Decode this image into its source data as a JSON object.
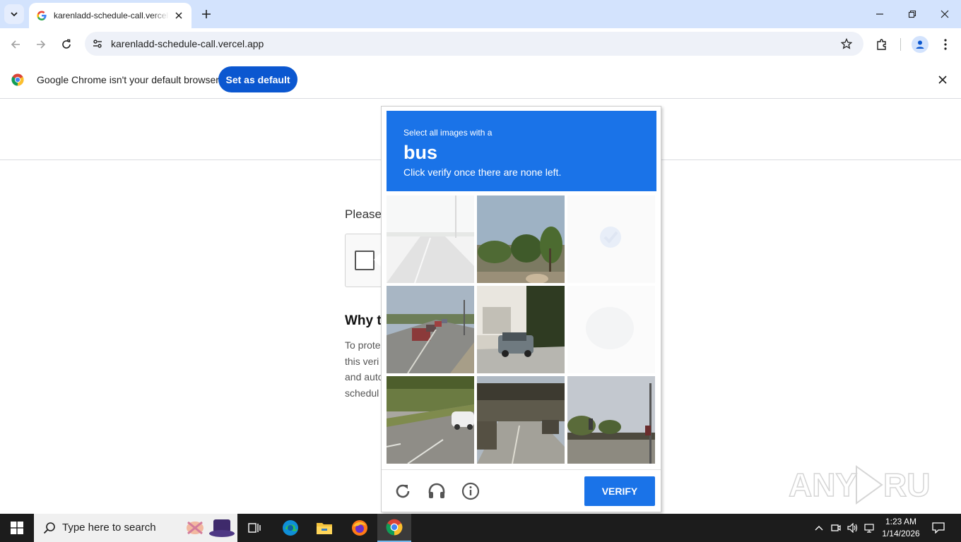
{
  "browser": {
    "tab_title": "karenladd-schedule-call.vercel.app",
    "url": "karenladd-schedule-call.vercel.app",
    "accent_color": "#d3e3fd"
  },
  "infobar": {
    "message": "Google Chrome isn't your default browser",
    "button_label": "Set as default",
    "button_color": "#0b57d0"
  },
  "page": {
    "please_text": "Please",
    "why_heading": "Why t",
    "para_lines": [
      "To prote",
      "this veri",
      "and auto",
      "schedul"
    ]
  },
  "captcha": {
    "instruction_line1": "Select all images with a",
    "target_word": "bus",
    "instruction_line3": "Click verify once there are none left.",
    "verify_label": "VERIFY",
    "header_color": "#1a73e8",
    "tiles": [
      {
        "scene": "highway-faded",
        "state": "fading"
      },
      {
        "scene": "trees-roadside",
        "state": "normal"
      },
      {
        "scene": "selected-fading",
        "state": "fading"
      },
      {
        "scene": "road-traffic",
        "state": "normal"
      },
      {
        "scene": "parked-suv",
        "state": "normal"
      },
      {
        "scene": "blank-fading",
        "state": "fading"
      },
      {
        "scene": "road-white-car",
        "state": "normal"
      },
      {
        "scene": "overpass",
        "state": "normal"
      },
      {
        "scene": "bridge-signal",
        "state": "normal"
      }
    ],
    "footer_icons": [
      "reload-icon",
      "headphones-icon",
      "info-icon"
    ]
  },
  "watermark": "ANY RUN",
  "taskbar": {
    "search_placeholder": "Type here to search",
    "time": "1:23 AM",
    "date": "1/14/2026"
  }
}
